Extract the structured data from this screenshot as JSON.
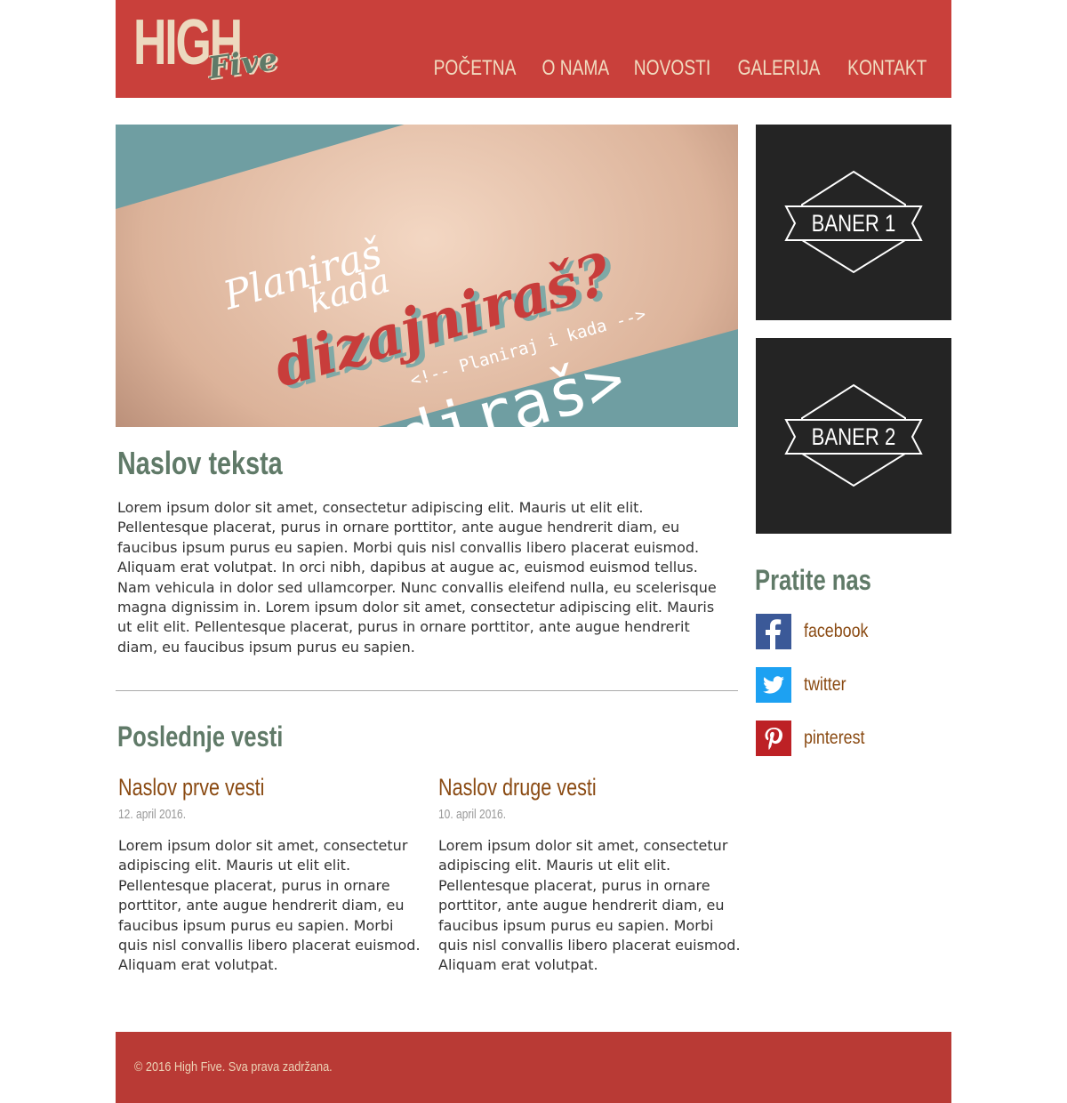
{
  "header": {
    "logo_top": "HIGH",
    "logo_bottom": "Five",
    "nav": [
      "POČETNA",
      "O NAMA",
      "NOVOSTI",
      "GALERIJA",
      "KONTAKT"
    ]
  },
  "hero": {
    "line1": "Planiraš",
    "line2": "kada",
    "line3": "dizajniraš?",
    "line4": "<!-- Planiraj i kada -->",
    "line5": "<kodiraš>"
  },
  "article": {
    "title": "Naslov teksta",
    "body": "Lorem ipsum dolor sit amet, consectetur adipiscing elit. Mauris ut elit elit. Pellentesque placerat, purus in ornare porttitor, ante augue hendrerit diam, eu faucibus ipsum purus eu sapien. Morbi quis nisl convallis libero placerat euismod. Aliquam erat volutpat. In orci nibh, dapibus at augue ac, euismod euismod tellus. Nam vehicula in dolor sed ullamcorper. Nunc convallis eleifend nulla, eu scelerisque magna dignissim in. Lorem ipsum dolor sit amet, consectetur adipiscing elit. Mauris ut elit elit. Pellentesque placerat, purus in ornare porttitor, ante augue hendrerit diam, eu faucibus ipsum purus eu sapien."
  },
  "news": {
    "heading": "Poslednje vesti",
    "items": [
      {
        "title": "Naslov prve vesti",
        "date": "12. april 2016.",
        "text": "Lorem ipsum dolor sit amet, consectetur adipiscing elit. Mauris ut elit elit. Pellentesque placerat, purus in ornare porttitor, ante augue hendrerit diam, eu faucibus ipsum purus eu sapien. Morbi quis nisl convallis libero placerat euismod. Aliquam erat volutpat."
      },
      {
        "title": "Naslov druge vesti",
        "date": "10. april 2016.",
        "text": "Lorem ipsum dolor sit amet, consectetur adipiscing elit. Mauris ut elit elit. Pellentesque placerat, purus in ornare porttitor, ante augue hendrerit diam, eu faucibus ipsum purus eu sapien. Morbi quis nisl convallis libero placerat euismod. Aliquam erat volutpat."
      }
    ]
  },
  "sidebar": {
    "banners": [
      "BANER 1",
      "BANER 2"
    ],
    "follow_heading": "Pratite nas",
    "social": [
      {
        "label": "facebook",
        "icon": "facebook-icon",
        "color": "#3b5998"
      },
      {
        "label": "twitter",
        "icon": "twitter-icon",
        "color": "#1da1f2"
      },
      {
        "label": "pinterest",
        "icon": "pinterest-icon",
        "color": "#bd2125"
      }
    ]
  },
  "footer": {
    "copyright": "© 2016 High Five. Sva prava zadržana."
  },
  "colors": {
    "header": "#c9403b",
    "footer": "#b93a35",
    "heading_green": "#607a68",
    "news_brown": "#8a4a12",
    "banner_bg": "#242424"
  }
}
